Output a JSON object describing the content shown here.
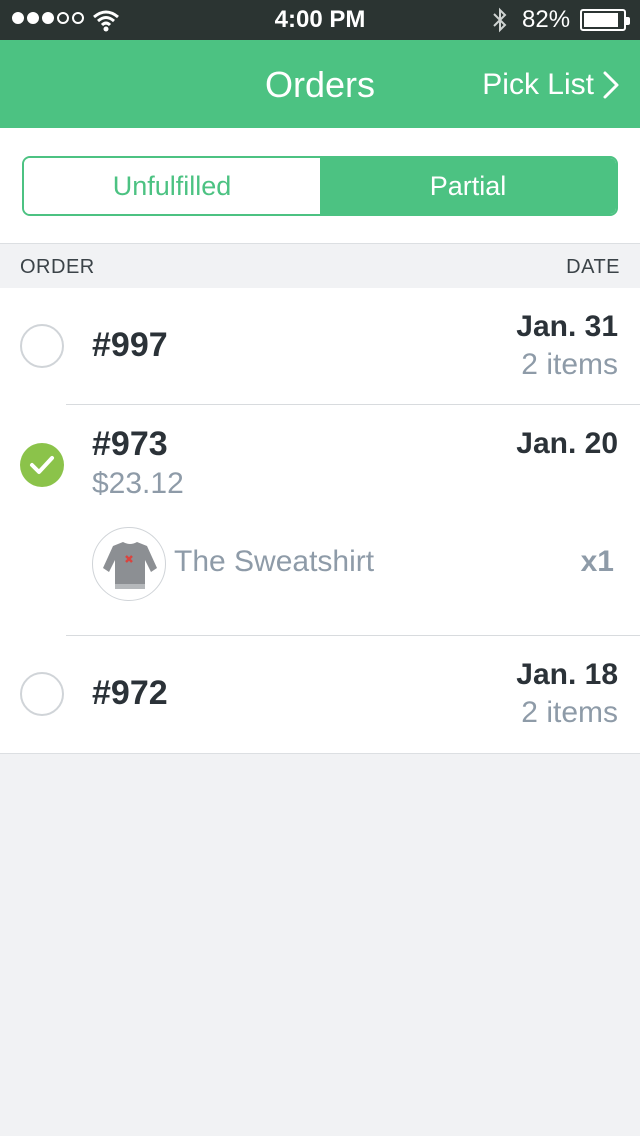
{
  "status_bar": {
    "time": "4:00 PM",
    "battery_percent": "82%",
    "signal_bars_filled": 3,
    "signal_bars_total": 5,
    "battery_level": 0.82,
    "icons": [
      "signal-dots-icon",
      "wifi-icon",
      "bluetooth-icon",
      "battery-icon"
    ]
  },
  "nav": {
    "title": "Orders",
    "right_label": "Pick List",
    "right_icon": "chevron-right-icon",
    "background_color": "#4cc282"
  },
  "segments": [
    {
      "label": "Unfulfilled",
      "selected": false
    },
    {
      "label": "Partial",
      "selected": true
    }
  ],
  "column_headers": {
    "left": "ORDER",
    "right": "DATE"
  },
  "orders": [
    {
      "number": "#997",
      "date": "Jan. 31",
      "items": "2 items",
      "checked": false
    },
    {
      "number": "#973",
      "date": "Jan. 20",
      "price": "$23.12",
      "checked": true,
      "line_item": {
        "name": "The Sweatshirt",
        "quantity": "x1",
        "image_icon": "sweatshirt-image"
      }
    },
    {
      "number": "#972",
      "date": "Jan. 18",
      "items": "2 items",
      "checked": false
    }
  ],
  "colors": {
    "accent": "#4cc282",
    "check": "#8bc34a",
    "muted_text": "#8e9ba8",
    "dark_text": "#2b3238"
  }
}
